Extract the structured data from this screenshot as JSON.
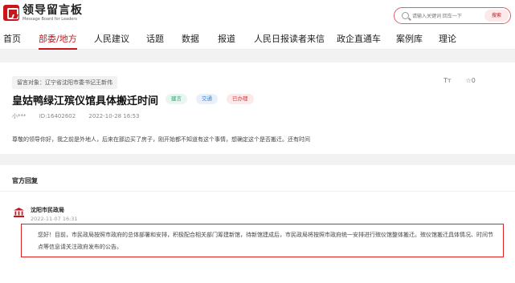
{
  "header": {
    "logo_cn": "领导留言板",
    "logo_en": "Message Board for Leaders",
    "search_placeholder": "请输入关键词 回车一下",
    "search_button": "搜索"
  },
  "nav": {
    "items": [
      "首页",
      "部委/地方",
      "人民建议",
      "话题",
      "数据",
      "报道",
      "人民日报读者来信",
      "政企直通车",
      "案例库",
      "理论"
    ],
    "active_index": 1
  },
  "post": {
    "target": "留言对象：辽宁省沈阳市委书记王新伟",
    "font_tool": "Tт",
    "favorite_count": "☆0",
    "title": "皇姑鸭绿江殡仪馆具体搬迁时间",
    "tags": [
      "建言",
      "交通",
      "已办理"
    ],
    "author": "小***",
    "id": "ID:16402602",
    "time": "2022-10-28 16:53",
    "content": "尊敬的领导你好，我之前是外地人，后来在那边买了房子，刚开始都不知道有这个事情，想确定这个是否搬迁。还有时间"
  },
  "reply": {
    "heading": "官方回复",
    "org": "沈阳市民政局",
    "time": "2022-11-07 16:31",
    "content": "您好！目前，市民政局按照市政府的总体部署和安排，积极配合相关部门筹建新馆，待新馆建成后，市民政局将按照市政府统一安排进行殡仪馆整体搬迁。殡仪馆搬迁具体情况、时间节点等信息请关注政府发布的公告。"
  },
  "colors": {
    "brand": "#c8161d",
    "highlight_border": "#e02020"
  }
}
